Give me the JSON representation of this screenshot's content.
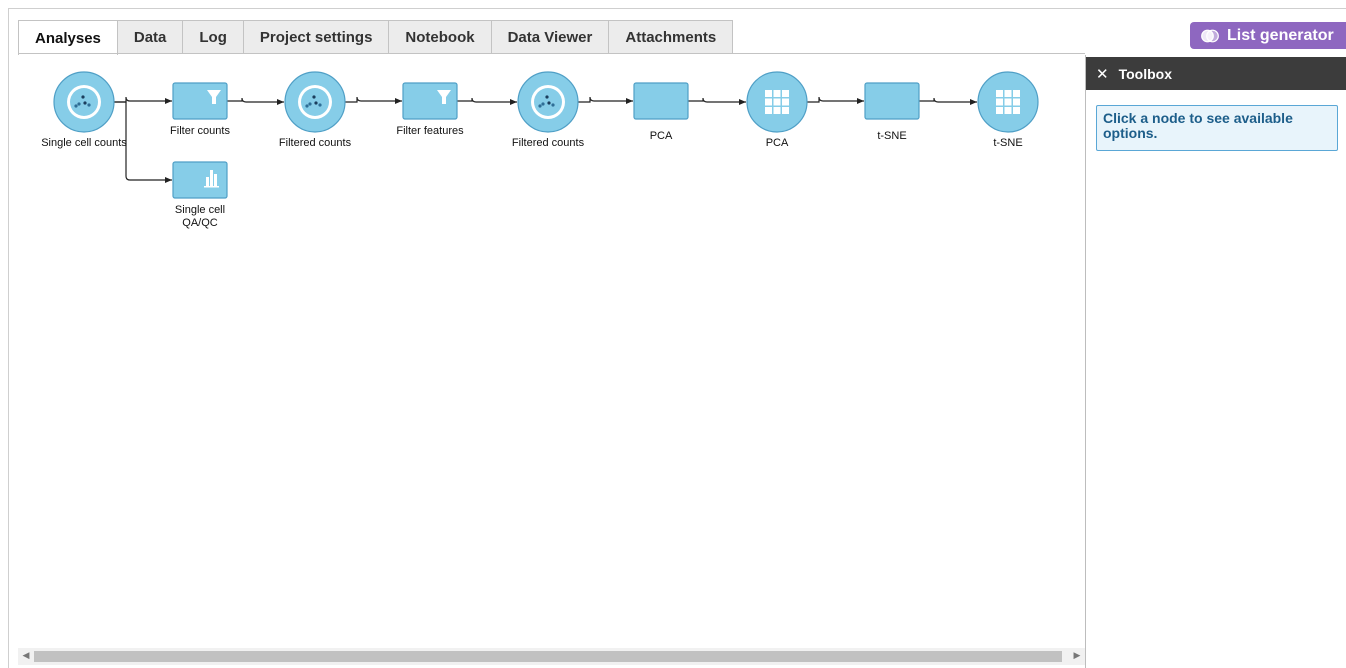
{
  "tabs": [
    {
      "label": "Analyses",
      "active": true
    },
    {
      "label": "Data",
      "active": false
    },
    {
      "label": "Log",
      "active": false
    },
    {
      "label": "Project settings",
      "active": false
    },
    {
      "label": "Notebook",
      "active": false
    },
    {
      "label": "Data Viewer",
      "active": false
    },
    {
      "label": "Attachments",
      "active": false
    }
  ],
  "list_generator": {
    "label": "List generator",
    "icon": "venn-icon"
  },
  "toolbox": {
    "title": "Toolbox",
    "close_icon": "close-icon",
    "hint": "Click a node to see available options."
  },
  "pipeline": {
    "nodes": [
      {
        "id": "n1",
        "kind": "data",
        "icon": "scatter-dots-icon",
        "label": "Single cell counts"
      },
      {
        "id": "n2",
        "kind": "task",
        "icon": "filter-icon",
        "label": "Filter counts"
      },
      {
        "id": "n3",
        "kind": "data",
        "icon": "scatter-dots-icon",
        "label": "Filtered counts"
      },
      {
        "id": "n4",
        "kind": "task",
        "icon": "filter-icon",
        "label": "Filter features"
      },
      {
        "id": "n5",
        "kind": "data",
        "icon": "scatter-dots-icon",
        "label": "Filtered counts"
      },
      {
        "id": "n6",
        "kind": "task",
        "icon": "",
        "label": "PCA"
      },
      {
        "id": "n7",
        "kind": "data",
        "icon": "grid-icon",
        "label": "PCA"
      },
      {
        "id": "n8",
        "kind": "task",
        "icon": "",
        "label": "t-SNE"
      },
      {
        "id": "n9",
        "kind": "data",
        "icon": "grid-icon",
        "label": "t-SNE"
      },
      {
        "id": "n10",
        "kind": "task",
        "icon": "bar-chart-icon",
        "label": "Single cell\nQA/QC"
      }
    ],
    "edges": [
      [
        "n1",
        "n2"
      ],
      [
        "n2",
        "n3"
      ],
      [
        "n3",
        "n4"
      ],
      [
        "n4",
        "n5"
      ],
      [
        "n5",
        "n6"
      ],
      [
        "n6",
        "n7"
      ],
      [
        "n7",
        "n8"
      ],
      [
        "n8",
        "n9"
      ],
      [
        "n1",
        "n10"
      ]
    ],
    "colors": {
      "fill": "#86cde8",
      "stroke": "#4f9fc6",
      "edge": "#222222",
      "icon": "#ffffff"
    }
  },
  "scrollbar": {
    "left_arrow": "◀",
    "right_arrow": "▶"
  }
}
